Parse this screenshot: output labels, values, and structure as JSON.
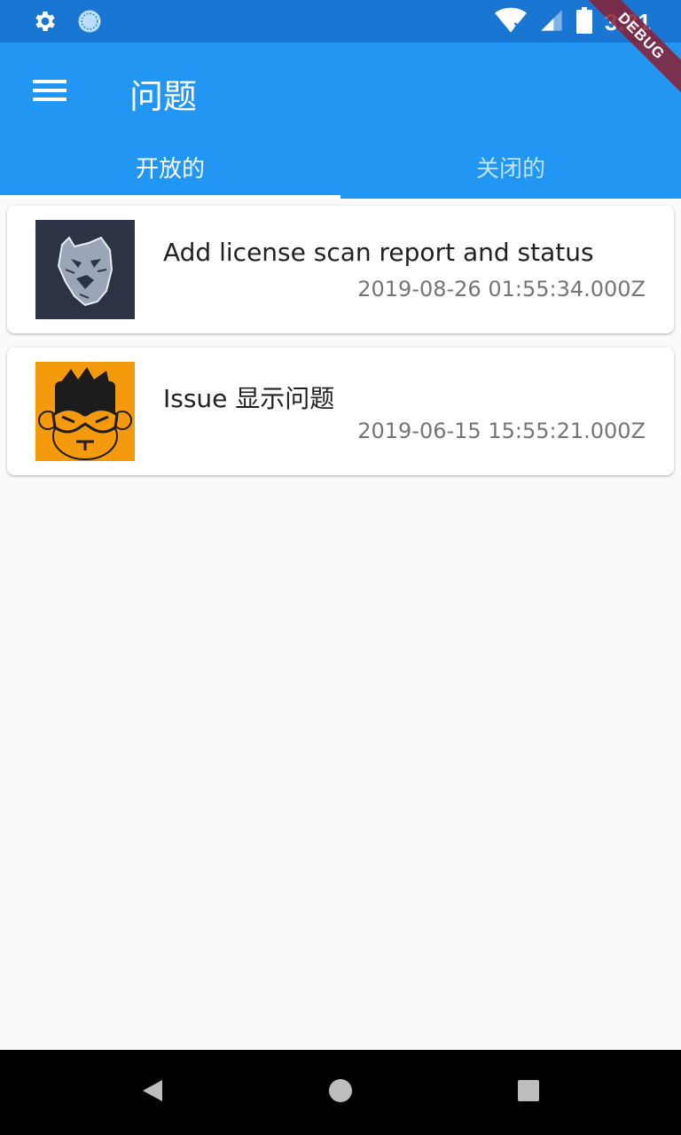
{
  "status_bar": {
    "time": "3:31",
    "icons": [
      "settings-icon",
      "sync-icon",
      "wifi-icon",
      "signal-icon",
      "battery-icon"
    ]
  },
  "debug_banner": {
    "label": "DEBUG"
  },
  "app_bar": {
    "title": "问题",
    "menu_icon": "menu-icon",
    "background": "#2196f3"
  },
  "tabs": [
    {
      "label": "开放的",
      "selected": true
    },
    {
      "label": "关闭的",
      "selected": false
    }
  ],
  "issues": [
    {
      "title": "Add license scan report and status",
      "date": "2019-08-26 01:55:34.000Z",
      "avatar": "tiger-avatar"
    },
    {
      "title": "Issue 显示问题",
      "date": "2019-06-15 15:55:21.000Z",
      "avatar": "monkey-avatar"
    }
  ],
  "nav_bar": {
    "icons": [
      "back-icon",
      "home-icon",
      "recents-icon"
    ]
  }
}
